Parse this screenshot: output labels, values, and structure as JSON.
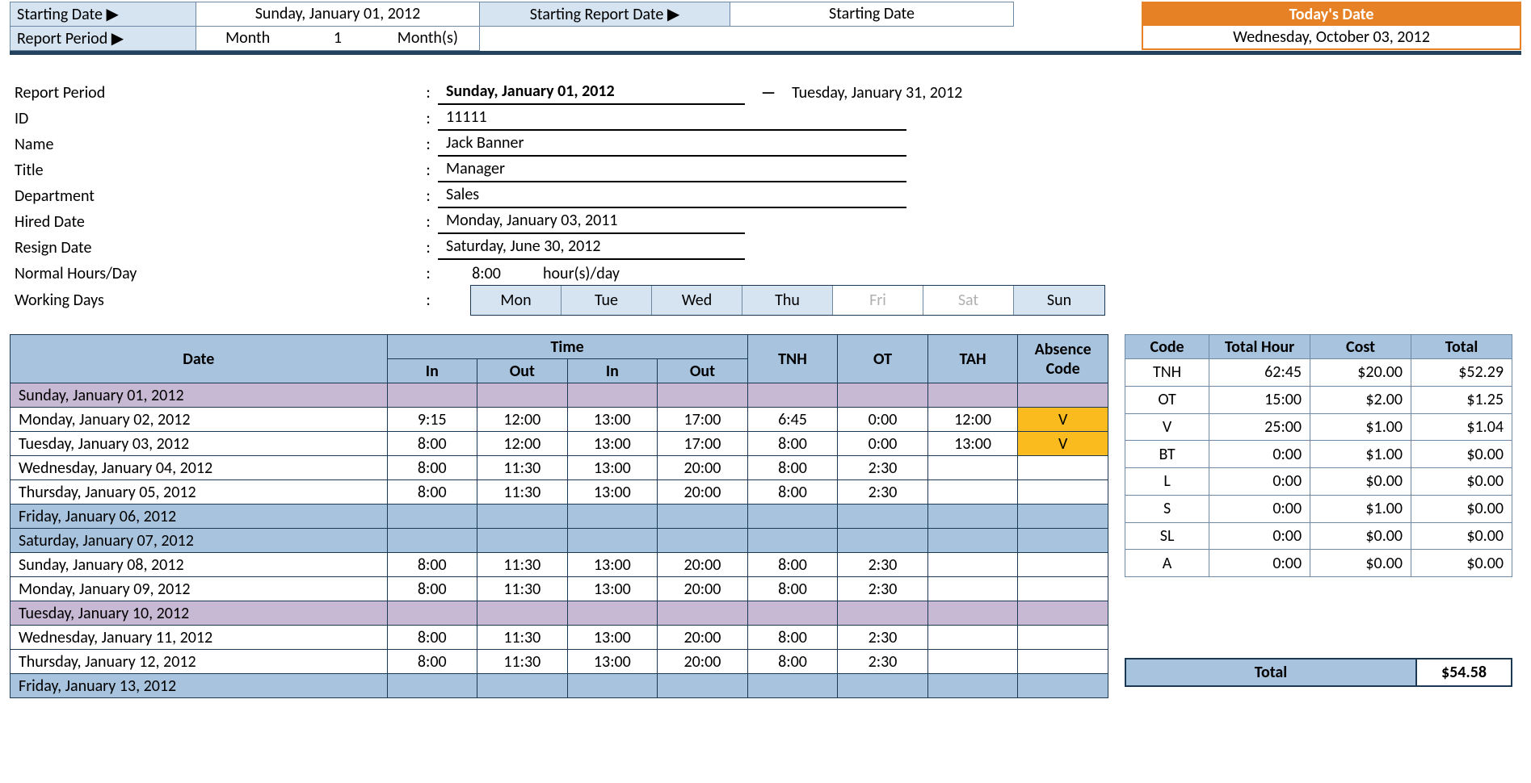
{
  "topbar": {
    "starting_date_label": "Starting Date ▶",
    "starting_date_value": "Sunday, January 01, 2012",
    "report_period_label": "Report Period ▶",
    "rp_unit": "Month",
    "rp_num": "1",
    "rp_suffix": "Month(s)",
    "starting_report_label": "Starting Report Date ▶",
    "starting_report_value": "Starting Date",
    "today_label": "Today's Date",
    "today_value": "Wednesday, October 03, 2012"
  },
  "info": {
    "report_period_lbl": "Report Period",
    "rp_from": "Sunday, January 01, 2012",
    "rp_dash": "—",
    "rp_to": "Tuesday, January 31, 2012",
    "id_lbl": "ID",
    "id_val": "11111",
    "name_lbl": "Name",
    "name_val": "Jack Banner",
    "title_lbl": "Title",
    "title_val": "Manager",
    "dept_lbl": "Department",
    "dept_val": "Sales",
    "hired_lbl": "Hired Date",
    "hired_val": "Monday, January 03, 2011",
    "resign_lbl": "Resign Date",
    "resign_val": "Saturday, June 30, 2012",
    "hours_lbl": "Normal Hours/Day",
    "hours_val": "8:00",
    "hours_unit": "hour(s)/day",
    "wdays_lbl": "Working Days",
    "days": [
      {
        "d": "Mon",
        "on": true
      },
      {
        "d": "Tue",
        "on": true
      },
      {
        "d": "Wed",
        "on": true
      },
      {
        "d": "Thu",
        "on": true
      },
      {
        "d": "Fri",
        "on": false
      },
      {
        "d": "Sat",
        "on": false
      },
      {
        "d": "Sun",
        "on": true
      }
    ]
  },
  "main_headers": {
    "date": "Date",
    "time": "Time",
    "in": "In",
    "out": "Out",
    "tnh": "TNH",
    "ot": "OT",
    "tah": "TAH",
    "ac": "Absence Code"
  },
  "main_rows": [
    {
      "date": "Sunday, January 01, 2012",
      "style": "purple"
    },
    {
      "date": "Monday, January 02, 2012",
      "in1": "9:15",
      "out1": "12:00",
      "in2": "13:00",
      "out2": "17:00",
      "tnh": "6:45",
      "ot": "0:00",
      "tah": "12:00",
      "ac": "V"
    },
    {
      "date": "Tuesday, January 03, 2012",
      "in1": "8:00",
      "out1": "12:00",
      "in2": "13:00",
      "out2": "17:00",
      "tnh": "8:00",
      "ot": "0:00",
      "tah": "13:00",
      "ac": "V"
    },
    {
      "date": "Wednesday, January 04, 2012",
      "in1": "8:00",
      "out1": "11:30",
      "in2": "13:00",
      "out2": "20:00",
      "tnh": "8:00",
      "ot": "2:30"
    },
    {
      "date": "Thursday, January 05, 2012",
      "in1": "8:00",
      "out1": "11:30",
      "in2": "13:00",
      "out2": "20:00",
      "tnh": "8:00",
      "ot": "2:30"
    },
    {
      "date": "Friday, January 06, 2012",
      "style": "blue"
    },
    {
      "date": "Saturday, January 07, 2012",
      "style": "blue"
    },
    {
      "date": "Sunday, January 08, 2012",
      "in1": "8:00",
      "out1": "11:30",
      "in2": "13:00",
      "out2": "20:00",
      "tnh": "8:00",
      "ot": "2:30"
    },
    {
      "date": "Monday, January 09, 2012",
      "in1": "8:00",
      "out1": "11:30",
      "in2": "13:00",
      "out2": "20:00",
      "tnh": "8:00",
      "ot": "2:30"
    },
    {
      "date": "Tuesday, January 10, 2012",
      "style": "purple"
    },
    {
      "date": "Wednesday, January 11, 2012",
      "in1": "8:00",
      "out1": "11:30",
      "in2": "13:00",
      "out2": "20:00",
      "tnh": "8:00",
      "ot": "2:30"
    },
    {
      "date": "Thursday, January 12, 2012",
      "in1": "8:00",
      "out1": "11:30",
      "in2": "13:00",
      "out2": "20:00",
      "tnh": "8:00",
      "ot": "2:30"
    },
    {
      "date": "Friday, January 13, 2012",
      "style": "blue"
    }
  ],
  "sum_headers": {
    "code": "Code",
    "th": "Total Hour",
    "cost": "Cost",
    "total": "Total"
  },
  "sum_rows": [
    {
      "code": "TNH",
      "th": "62:45",
      "cost": "$20.00",
      "total": "$52.29"
    },
    {
      "code": "OT",
      "th": "15:00",
      "cost": "$2.00",
      "total": "$1.25"
    },
    {
      "code": "V",
      "th": "25:00",
      "cost": "$1.00",
      "total": "$1.04"
    },
    {
      "code": "BT",
      "th": "0:00",
      "cost": "$1.00",
      "total": "$0.00"
    },
    {
      "code": "L",
      "th": "0:00",
      "cost": "$0.00",
      "total": "$0.00"
    },
    {
      "code": "S",
      "th": "0:00",
      "cost": "$1.00",
      "total": "$0.00"
    },
    {
      "code": "SL",
      "th": "0:00",
      "cost": "$0.00",
      "total": "$0.00"
    },
    {
      "code": "A",
      "th": "0:00",
      "cost": "$0.00",
      "total": "$0.00"
    }
  ],
  "grand_total": {
    "label": "Total",
    "value": "$54.58"
  }
}
